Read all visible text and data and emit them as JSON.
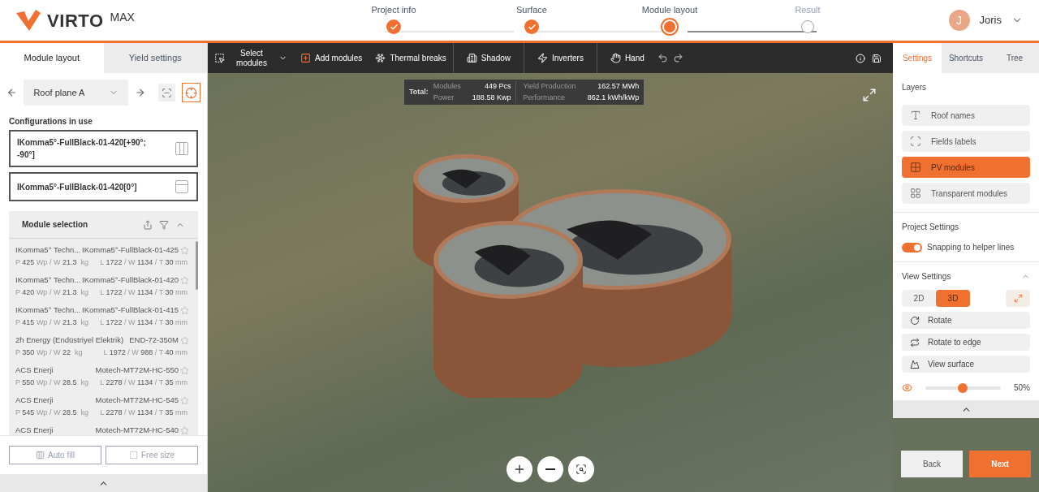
{
  "logo": {
    "brand": "VIRTO",
    "suffix": "MAX"
  },
  "steps": [
    {
      "label": "Project info",
      "completed": true,
      "current": false
    },
    {
      "label": "Surface",
      "completed": true,
      "current": false
    },
    {
      "label": "Module layout",
      "completed": false,
      "current": true
    },
    {
      "label": "Result",
      "completed": false,
      "current": false
    }
  ],
  "user": {
    "initial": "J",
    "name": "Joris"
  },
  "left_tabs": [
    {
      "label": "Module layout",
      "selected": true
    },
    {
      "label": "Yield settings",
      "selected": false
    }
  ],
  "roof_select": {
    "value": "Roof plane A"
  },
  "configurations": {
    "title": "Configurations in use",
    "items": [
      {
        "label": "IKomma5°-FullBlack-01-420[+90°; -90°]",
        "kind": "double"
      },
      {
        "label": "IKomma5°-FullBlack-01-420[0°]",
        "kind": "single"
      }
    ]
  },
  "module_selection": {
    "title": "Module selection",
    "items": [
      {
        "vendor": "IKomma5° Techn...",
        "model": "IKomma5°-FullBlack-01-425",
        "power_weight": "P **425** Wp / W **21.3**  kg",
        "dimensions": "L **1722** / W **1134** / T **30** mm",
        "favorite": false
      },
      {
        "vendor": "IKomma5° Techn...",
        "model": "IKomma5°-FullBlack-01-420",
        "power_weight": "P **420** Wp / W **21.3**  kg",
        "dimensions": "L **1722** / W **1134** / T **30** mm",
        "favorite": false
      },
      {
        "vendor": "IKomma5° Techn...",
        "model": "IKomma5°-FullBlack-01-415",
        "power_weight": "P **415** Wp / W **21.3**  kg",
        "dimensions": "L **1722** / W **1134** / T **30** mm",
        "favorite": false
      },
      {
        "vendor": "2h Energy (Endüstriyel Elektrik)",
        "model": "END-72-350M",
        "power_weight": "P **350** Wp / W **22**  kg",
        "dimensions": "L **1972** / W **988** / T **40** mm",
        "favorite": false
      },
      {
        "vendor": "ACS Enerji",
        "model": "Motech-MT72M-HC-550",
        "power_weight": "P **550** Wp / W **28.5**  kg",
        "dimensions": "L **2278** / W **1134** / T **35** mm",
        "favorite": false
      },
      {
        "vendor": "ACS Enerji",
        "model": "Motech-MT72M-HC-545",
        "power_weight": "P **545** Wp / W **28.5**  kg",
        "dimensions": "L **2278** / W **1134** / T **35** mm",
        "favorite": false
      },
      {
        "vendor": "ACS Enerji",
        "model": "Motech-MT72M-HC-540",
        "favorite": false
      }
    ]
  },
  "footer_buttons": [
    {
      "label": "Auto fill",
      "kind": "autofill"
    },
    {
      "label": "Free size",
      "kind": "freesize"
    }
  ],
  "toolbar": [
    {
      "label": "Select modules",
      "kind": "select",
      "active": false
    },
    {
      "label": "Add modules",
      "kind": "add",
      "active": true
    },
    {
      "label": "Thermal breaks",
      "kind": "thermal",
      "active": false
    },
    {
      "label": "Shadow",
      "kind": "shadow",
      "active": false
    },
    {
      "label": "Inverters",
      "kind": "inverters",
      "active": false
    },
    {
      "label": "Hand",
      "kind": "hand",
      "active": false
    }
  ],
  "stats": {
    "label": "Total:",
    "items": [
      {
        "name": "Modules",
        "value": "449 Pcs"
      },
      {
        "name": "Power",
        "value": "188.58 Kwp"
      },
      {
        "name": "Yield Production",
        "value": "162.57 MWh"
      },
      {
        "name": "Performance",
        "value": "862.1 kWh/kWp"
      }
    ]
  },
  "right_tabs": [
    {
      "label": "Settings",
      "selected": true
    },
    {
      "label": "Shortcuts",
      "selected": false
    },
    {
      "label": "Tree",
      "selected": false
    }
  ],
  "layers": {
    "title": "Layers",
    "items": [
      {
        "label": "Roof names",
        "kind": "roof",
        "selected": false
      },
      {
        "label": "Fields labels",
        "kind": "fields",
        "selected": false
      },
      {
        "label": "PV modules",
        "kind": "pv",
        "selected": true
      },
      {
        "label": "Transparent modules",
        "kind": "transparent",
        "selected": false
      }
    ]
  },
  "project_settings": {
    "title": "Project Settings",
    "toggle": {
      "label": "Snapping to helper lines",
      "on": true
    }
  },
  "view_settings": {
    "title": "View Settings",
    "modes": [
      {
        "label": "2D",
        "selected": false
      },
      {
        "label": "3D",
        "selected": true
      }
    ],
    "actions": [
      {
        "label": "Rotate",
        "kind": "rotate"
      },
      {
        "label": "Rotate to edge",
        "kind": "edge"
      },
      {
        "label": "View surface",
        "kind": "surface"
      }
    ],
    "opacity": {
      "level": 0.5,
      "reading": "50%"
    }
  },
  "nav_buttons": [
    {
      "label": "Back",
      "kind": "secondary"
    },
    {
      "label": "Next",
      "kind": "primary"
    }
  ]
}
